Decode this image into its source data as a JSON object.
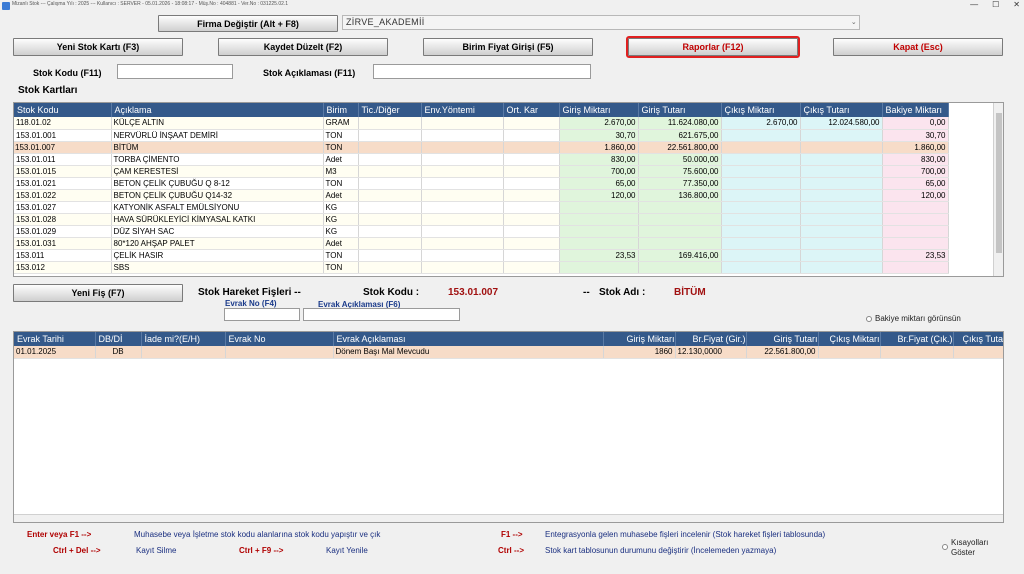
{
  "window": {
    "title": "Mizanlı Stok  ---  Çalışma Yılı : 2025  ---  Kullanıcı : SERVER - 05.01.2026 - 18:08:17 - Müş.No : 404881 - Ver.No : 031225.02.1",
    "min": "—",
    "max": "☐",
    "close": "✕"
  },
  "toolbar": {
    "firma_button": "Firma Değiştir (Alt + F8)",
    "company_value": "ZİRVE_AKADEMİİ",
    "yeni_stok": "Yeni Stok Kartı (F3)",
    "kaydet": "Kaydet Düzelt (F2)",
    "birim_fiyat": "Birim Fiyat Girişi  (F5)",
    "raporlar": "Raporlar (F12)",
    "kapat": "Kapat (Esc)"
  },
  "filters": {
    "stok_kodu_label": "Stok Kodu (F11)",
    "stok_aciklama_label": "Stok Açıklaması (F11)",
    "stok_kodu_value": "",
    "stok_aciklama_value": ""
  },
  "stok_kartlari": {
    "title": "Stok Kartları",
    "columns": [
      "Stok Kodu",
      "Açıklama",
      "Birim",
      "Tic./Diğer",
      "Env.Yöntemi",
      "Ort. Kar",
      "Giriş Miktarı",
      "Giriş Tutarı",
      "Çıkış Miktarı",
      "Çıkış Tutarı",
      "Bakiye Miktarı"
    ],
    "rows": [
      {
        "kod": "118.01.02",
        "aciklama": "KÜLÇE ALTIN",
        "birim": "GRAM",
        "giris_miktar": "2.670,00",
        "giris_tutar": "11.624.080,00",
        "cikis_miktar": "2.670,00",
        "cikis_tutar": "12.024.580,00",
        "bakiye": "0,00"
      },
      {
        "kod": "153.01.001",
        "aciklama": "NERVÜRLÜ İNŞAAT DEMİRİ",
        "birim": "TON",
        "giris_miktar": "30,70",
        "giris_tutar": "621.675,00",
        "cikis_miktar": "",
        "cikis_tutar": "",
        "bakiye": "30,70"
      },
      {
        "kod": "153.01.007",
        "aciklama": "BİTÜM",
        "birim": "TON",
        "giris_miktar": "1.860,00",
        "giris_tutar": "22.561.800,00",
        "cikis_miktar": "",
        "cikis_tutar": "",
        "bakiye": "1.860,00",
        "selected": true
      },
      {
        "kod": "153.01.011",
        "aciklama": "TORBA ÇİMENTO",
        "birim": "Adet",
        "giris_miktar": "830,00",
        "giris_tutar": "50.000,00",
        "cikis_miktar": "",
        "cikis_tutar": "",
        "bakiye": "830,00"
      },
      {
        "kod": "153.01.015",
        "aciklama": "ÇAM KERESTESİ",
        "birim": "M3",
        "giris_miktar": "700,00",
        "giris_tutar": "75.600,00",
        "cikis_miktar": "",
        "cikis_tutar": "",
        "bakiye": "700,00"
      },
      {
        "kod": "153.01.021",
        "aciklama": "BETON ÇELİK ÇUBUĞU Q 8-12",
        "birim": "TON",
        "giris_miktar": "65,00",
        "giris_tutar": "77.350,00",
        "cikis_miktar": "",
        "cikis_tutar": "",
        "bakiye": "65,00"
      },
      {
        "kod": "153.01.022",
        "aciklama": "BETON ÇELİK ÇUBUĞU Q14-32",
        "birim": "Adet",
        "giris_miktar": "120,00",
        "giris_tutar": "136.800,00",
        "cikis_miktar": "",
        "cikis_tutar": "",
        "bakiye": "120,00"
      },
      {
        "kod": "153.01.027",
        "aciklama": "KATYONİK ASFALT EMÜLSİYONU",
        "birim": "KG",
        "giris_miktar": "",
        "giris_tutar": "",
        "cikis_miktar": "",
        "cikis_tutar": "",
        "bakiye": ""
      },
      {
        "kod": "153.01.028",
        "aciklama": "HAVA SÜRÜKLEYİCİ KİMYASAL KATKI",
        "birim": "KG",
        "giris_miktar": "",
        "giris_tutar": "",
        "cikis_miktar": "",
        "cikis_tutar": "",
        "bakiye": ""
      },
      {
        "kod": "153.01.029",
        "aciklama": "DÜZ SİYAH SAC",
        "birim": "KG",
        "giris_miktar": "",
        "giris_tutar": "",
        "cikis_miktar": "",
        "cikis_tutar": "",
        "bakiye": ""
      },
      {
        "kod": "153.01.031",
        "aciklama": "80*120 AHŞAP PALET",
        "birim": "Adet",
        "giris_miktar": "",
        "giris_tutar": "",
        "cikis_miktar": "",
        "cikis_tutar": "",
        "bakiye": ""
      },
      {
        "kod": "153.011",
        "aciklama": "ÇELİK HASIR",
        "birim": "TON",
        "giris_miktar": "23,53",
        "giris_tutar": "169.416,00",
        "cikis_miktar": "",
        "cikis_tutar": "",
        "bakiye": "23,53"
      },
      {
        "kod": "153.012",
        "aciklama": "SBS",
        "birim": "TON",
        "giris_miktar": "",
        "giris_tutar": "",
        "cikis_miktar": "",
        "cikis_tutar": "",
        "bakiye": ""
      }
    ]
  },
  "hareket": {
    "yeni_fis": "Yeni Fiş (F7)",
    "title": "Stok Hareket Fişleri  --",
    "stok_kodu_label": "Stok Kodu :",
    "stok_kodu_value": "153.01.007",
    "sep": "--",
    "stok_adi_label": "Stok Adı :",
    "stok_adi_value": "BİTÜM",
    "evrak_no_label": "Evrak No (F4)",
    "evrak_aciklama_label": "Evrak Açıklaması (F6)",
    "bakiye_option": "Bakiye miktarı görünsün",
    "columns": [
      "Evrak Tarihi",
      "DB/Dİ",
      "İade mi?(E/H)",
      "Evrak No",
      "Evrak Açıklaması",
      "Giriş Miktarı",
      "Br.Fiyat (Gir.)",
      "Giriş Tutarı",
      "Çıkış Miktarı",
      "Br.Fiyat (Çık.)",
      "Çıkış Tutarı"
    ],
    "rows": [
      {
        "tarih": "01.01.2025",
        "db": "DB",
        "iade": "",
        "evrak_no": "",
        "aciklama": "Dönem Başı Mal Mevcudu",
        "giris_miktar": "1860",
        "br_fiyat": "12.130,0000",
        "giris_tutar": "22.561.800,00",
        "cikis_miktar": "",
        "br_fiyat_cik": "",
        "cikis_tutar": ""
      }
    ]
  },
  "footer": {
    "k1": "Enter veya F1 -->",
    "d1": "Muhasebe veya İşletme stok kodu alanlarına  stok kodu yapıştır ve çık",
    "k2": "F1 -->",
    "d2": "Entegrasyonla gelen muhasebe fişleri incelenir (Stok hareket fişleri tablosunda)",
    "k3": "Ctrl + Del -->",
    "d3": "Kayıt Silme",
    "k4": "Ctrl + F9 -->",
    "d4": "Kayıt Yenile",
    "k5": "Ctrl  -->",
    "d5": "Stok kart tablosunun durumunu değiştirir (İncelemeden yazmaya)",
    "kisayol": "Kısayolları\nGöster"
  }
}
